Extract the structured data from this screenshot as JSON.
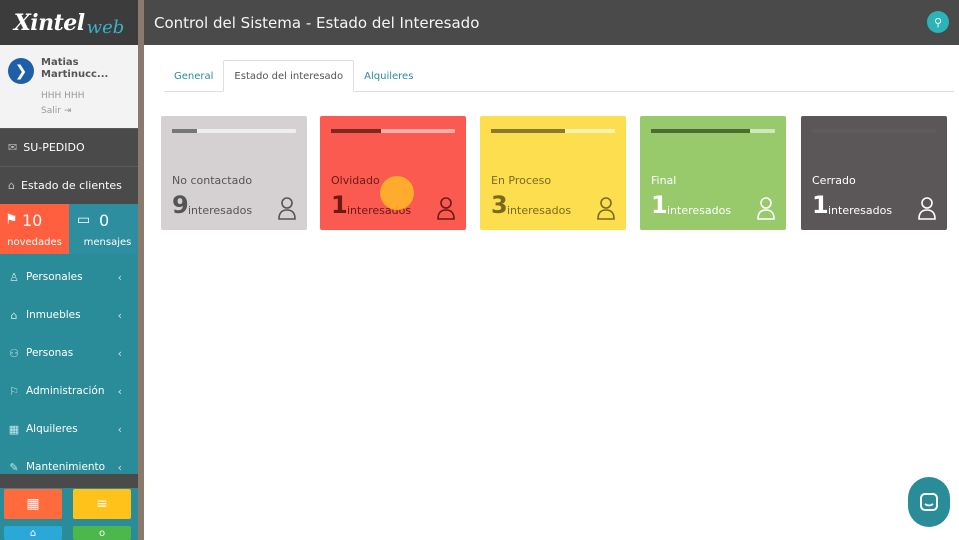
{
  "sidebar": {
    "logo": {
      "brand": "Xintel",
      "sub": "web"
    },
    "profile": {
      "name": "Matias Martinucc...",
      "tags": "HHH  HHH",
      "logout": "Salir"
    },
    "menu": [
      {
        "label": "SU-PEDIDO",
        "icon": "megaphone-icon"
      },
      {
        "label": "Estado de clientes",
        "icon": "tag-icon"
      }
    ],
    "notifications": [
      {
        "count": "10",
        "label": "novedades",
        "icon": "megaphone-icon",
        "color": "#ff5f3f"
      },
      {
        "count": "0",
        "label": "mensajes",
        "icon": "chat-icon",
        "color": "#2d8ea0"
      }
    ],
    "nav": [
      {
        "label": "Personales",
        "icon": "person-icon"
      },
      {
        "label": "Inmuebles",
        "icon": "home-icon"
      },
      {
        "label": "Personas",
        "icon": "people-icon"
      },
      {
        "label": "Administración",
        "icon": "flag-icon"
      },
      {
        "label": "Alquileres",
        "icon": "calendar-icon"
      },
      {
        "label": "Mantenimiento",
        "icon": "wrench-icon"
      }
    ]
  },
  "header": {
    "title": "Control del Sistema - Estado del Interesado"
  },
  "tabs": [
    {
      "label": "General",
      "active": false
    },
    {
      "label": "Estado del interesado",
      "active": true
    },
    {
      "label": "Alquileres",
      "active": false
    }
  ],
  "cards": [
    {
      "name": "No contactado",
      "count": "9",
      "unit": "interesados",
      "bg": "#d5d1d2",
      "text": "#555555",
      "bar_fill": 0.2,
      "bar_bg": "#eeeeee",
      "bar_color": "#777777"
    },
    {
      "name": "Olvidado",
      "count": "1",
      "unit": "interesados",
      "bg": "#fa5a50",
      "text": "#6b1a14",
      "bar_fill": 0.4,
      "bar_bg": "#ffb0ac",
      "bar_color": "#7a2a24"
    },
    {
      "name": "En Proceso",
      "count": "3",
      "unit": "interesados",
      "bg": "#fcde4f",
      "text": "#7a6a20",
      "bar_fill": 0.6,
      "bar_bg": "#fff3b0",
      "bar_color": "#8a7a30"
    },
    {
      "name": "Final",
      "count": "1",
      "unit": "interesados",
      "bg": "#98c96a",
      "text": "#ffffff",
      "bar_fill": 0.8,
      "bar_bg": "#d0e8bb",
      "bar_color": "#4d6b33"
    },
    {
      "name": "Cerrado",
      "count": "1",
      "unit": "interesados",
      "bg": "#5b5758",
      "text": "#ffffff",
      "bar_fill": 1.0,
      "bar_bg": "#6a6667",
      "bar_color": "#5f5b5c"
    }
  ]
}
